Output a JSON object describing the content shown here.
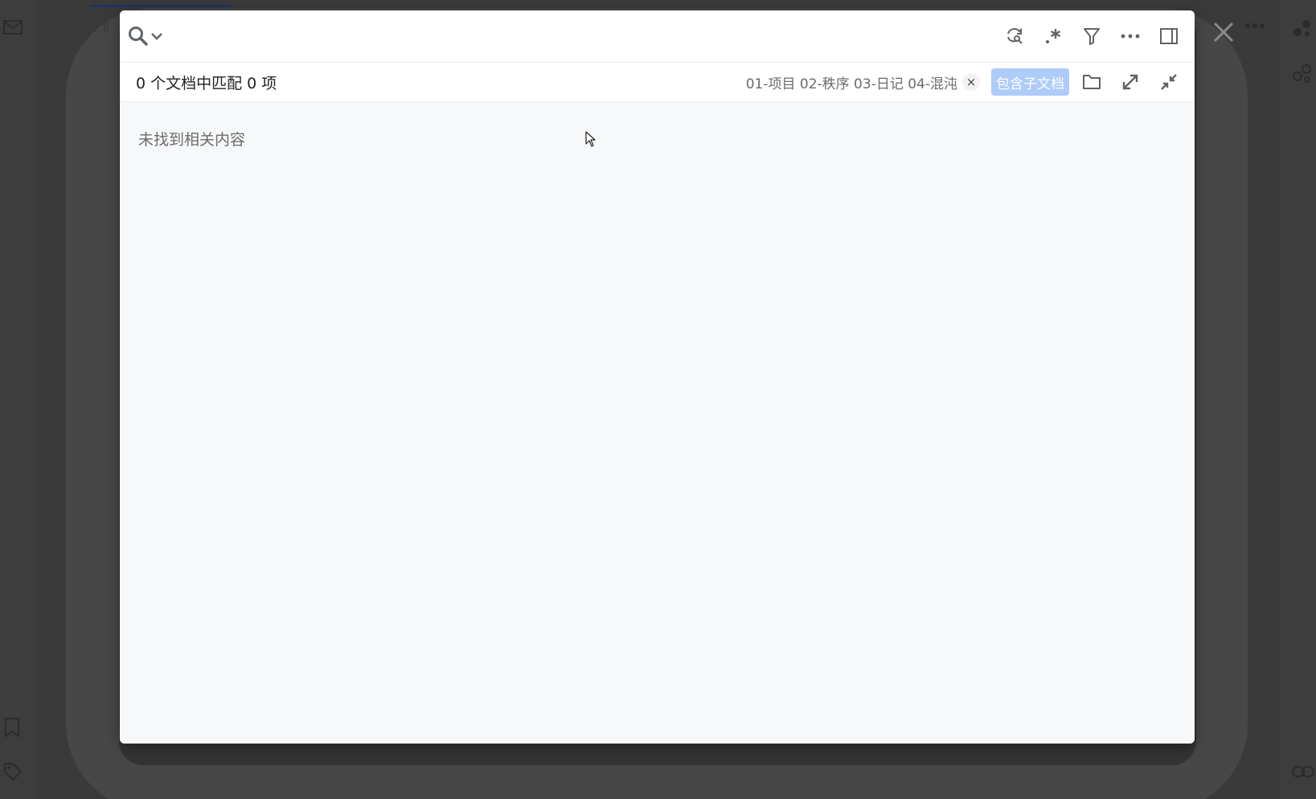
{
  "search": {
    "value": "",
    "placeholder": ""
  },
  "toolbar": {
    "icons": [
      "refresh-search-icon",
      "regex-icon",
      "filter-icon",
      "more-icon",
      "sidebar-panel-icon"
    ]
  },
  "info_bar": {
    "match_count": "0 个文档中匹配 0 项",
    "path": "01-项目 02-秩序 03-日记 04-混沌",
    "clear_symbol": "×",
    "include_child_label": "包含子文档"
  },
  "results": {
    "empty_message": "未找到相关内容"
  },
  "colors": {
    "overlay": "#3a3a3a",
    "dialog_bg": "#f6f8fa",
    "header_bg": "#ffffff",
    "accent_button": "#aecbfa",
    "icon": "#5f6368",
    "muted_text": "#6b6b6b"
  }
}
